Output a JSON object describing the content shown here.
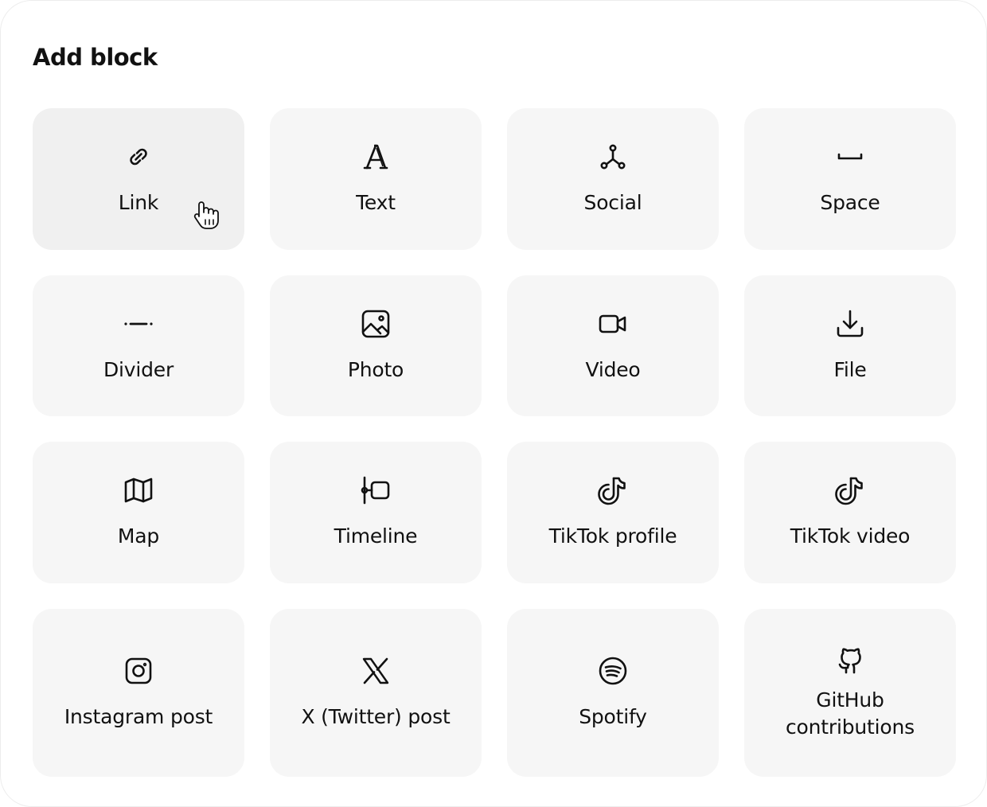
{
  "panel": {
    "title": "Add block"
  },
  "blocks": [
    {
      "label": "Link",
      "icon": "link-icon"
    },
    {
      "label": "Text",
      "icon": "text-icon"
    },
    {
      "label": "Social",
      "icon": "social-icon"
    },
    {
      "label": "Space",
      "icon": "space-icon"
    },
    {
      "label": "Divider",
      "icon": "divider-icon"
    },
    {
      "label": "Photo",
      "icon": "photo-icon"
    },
    {
      "label": "Video",
      "icon": "video-icon"
    },
    {
      "label": "File",
      "icon": "download-icon"
    },
    {
      "label": "Map",
      "icon": "map-icon"
    },
    {
      "label": "Timeline",
      "icon": "timeline-icon"
    },
    {
      "label": "TikTok profile",
      "icon": "tiktok-icon"
    },
    {
      "label": "TikTok video",
      "icon": "tiktok-icon"
    },
    {
      "label": "Instagram post",
      "icon": "instagram-icon"
    },
    {
      "label": "X (Twitter) post",
      "icon": "x-twitter-icon"
    },
    {
      "label": "Spotify",
      "icon": "spotify-icon"
    },
    {
      "label": "GitHub contributions",
      "icon": "github-icon"
    }
  ],
  "hovered_block": "Link",
  "cursor_icon": "hand-pointer-icon"
}
